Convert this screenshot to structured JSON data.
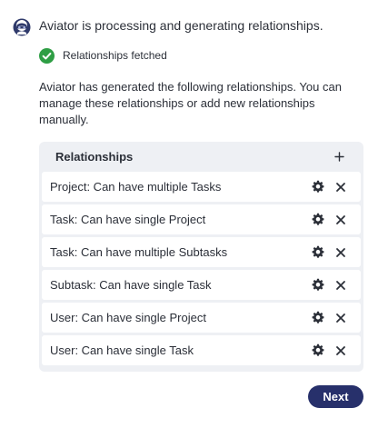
{
  "header": {
    "avatar_icon": "aviator-avatar-icon",
    "message": "Aviator is processing and generating relationships."
  },
  "status": {
    "icon": "check-circle-icon",
    "text": "Relationships fetched",
    "color": "#2e9e44"
  },
  "intro": {
    "text": "Aviator has generated the following relationships. You can manage these relationships or add new relationships manually."
  },
  "relationships": {
    "title": "Relationships",
    "add_icon": "plus-icon",
    "items": [
      {
        "label": "Project: Can have multiple Tasks"
      },
      {
        "label": "Task: Can have single Project"
      },
      {
        "label": "Task: Can have multiple Subtasks"
      },
      {
        "label": "Subtask: Can have single Task"
      },
      {
        "label": "User: Can have single Project"
      },
      {
        "label": "User: Can have single Task"
      }
    ],
    "row_icons": [
      "gear-icon",
      "close-icon"
    ]
  },
  "footer": {
    "next_label": "Next",
    "button_color": "#27306b"
  }
}
